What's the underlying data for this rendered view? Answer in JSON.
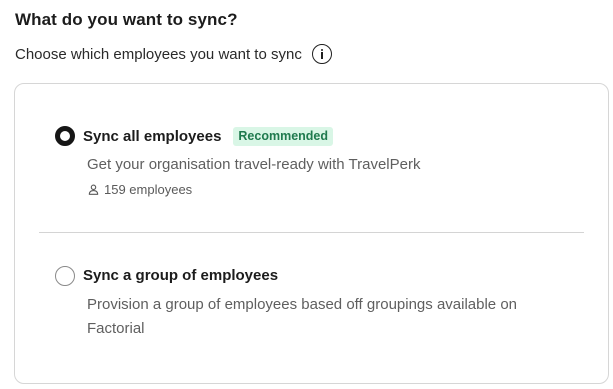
{
  "heading": "What do you want to sync?",
  "subheading": "Choose which employees you want to sync",
  "options": [
    {
      "title": "Sync all employees",
      "badge": "Recommended",
      "description": "Get your organisation travel-ready with TravelPerk",
      "meta": "159 employees",
      "selected": true
    },
    {
      "title": "Sync a group of employees",
      "description": "Provision a group of employees based off groupings available on Factorial",
      "selected": false
    }
  ],
  "icons": {
    "info": "info-icon",
    "person": "person-icon"
  },
  "colors": {
    "badge_text": "#1f7a4e",
    "badge_background": "#d9f6e6",
    "border": "#d6d6d6"
  }
}
